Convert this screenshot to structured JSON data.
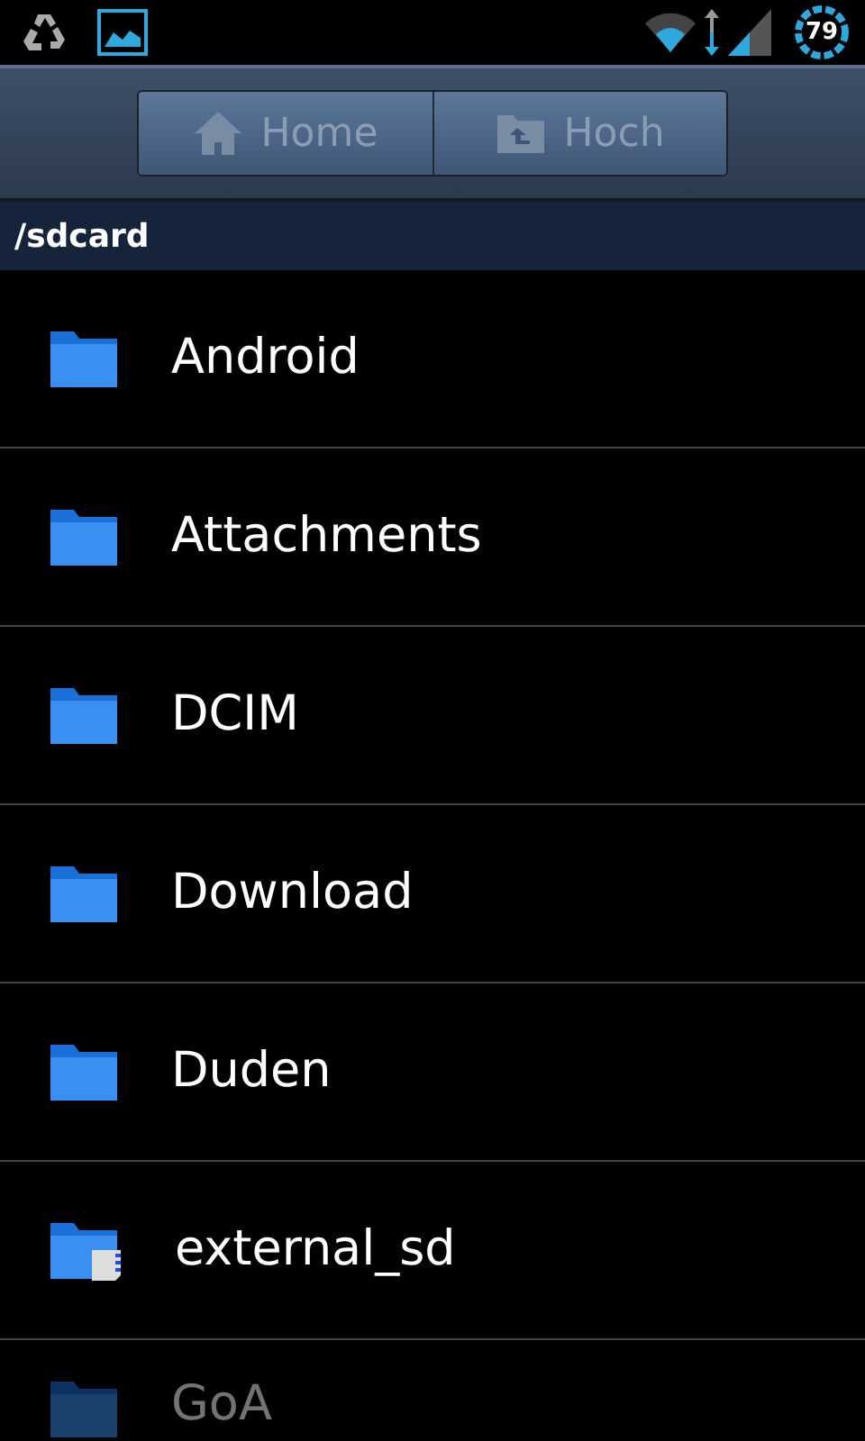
{
  "status_bar": {
    "battery": "79"
  },
  "toolbar": {
    "buttons": [
      {
        "label": "Home",
        "kind": "home",
        "disabled": true
      },
      {
        "label": "Hoch",
        "kind": "up",
        "disabled": true
      }
    ]
  },
  "path": "/sdcard",
  "items": [
    {
      "name": "Android",
      "kind": "folder"
    },
    {
      "name": "Attachments",
      "kind": "folder"
    },
    {
      "name": "DCIM",
      "kind": "folder"
    },
    {
      "name": "Download",
      "kind": "folder"
    },
    {
      "name": "Duden",
      "kind": "folder"
    },
    {
      "name": "external_sd",
      "kind": "sd-folder"
    },
    {
      "name": "GoA",
      "kind": "folder"
    }
  ]
}
